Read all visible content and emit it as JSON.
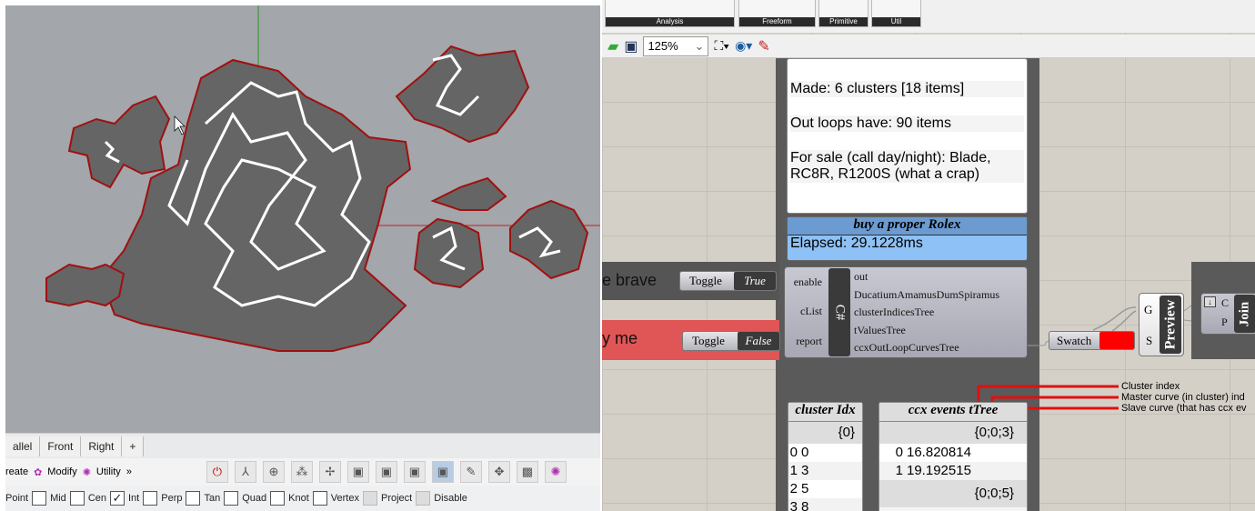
{
  "rhino": {
    "view_tabs": [
      "allel",
      "Front",
      "Right",
      "+"
    ],
    "toolbar_tabs": [
      {
        "label": "reate"
      },
      {
        "label": "Modify",
        "icon": "modify-icon"
      },
      {
        "label": "Utility",
        "icon": "utility-icon"
      },
      {
        "label": "»"
      }
    ],
    "osnaps": [
      {
        "label": "Point",
        "checked": null
      },
      {
        "label": "Mid",
        "checked": false
      },
      {
        "label": "Cen",
        "checked": false
      },
      {
        "label": "Int",
        "checked": true
      },
      {
        "label": "Perp",
        "checked": false
      },
      {
        "label": "Tan",
        "checked": false
      },
      {
        "label": "Quad",
        "checked": false
      },
      {
        "label": "Knot",
        "checked": false
      },
      {
        "label": "Vertex",
        "checked": false
      },
      {
        "label": "Project",
        "checked": false,
        "disabled": true
      },
      {
        "label": "Disable",
        "checked": false,
        "disabled": true
      }
    ]
  },
  "grasshopper": {
    "ribbon_groups": [
      "Analysis",
      "Freeform",
      "Primitive",
      "Util"
    ],
    "zoom": "125%",
    "panel_lines": [
      "Made: 6 clusters [18 items]",
      "Out loops have: 90 items",
      "For sale (call day/night): Blade, RC8R, R1200S (what a crap)"
    ],
    "timer": {
      "title": "buy a proper Rolex",
      "text": "Elapsed: 29.1228ms"
    },
    "group_brave": "e brave",
    "group_me": "y me",
    "toggle_true": {
      "label": "Toggle",
      "value": "True"
    },
    "toggle_false": {
      "label": "Toggle",
      "value": "False"
    },
    "csharp": {
      "name": "C#",
      "inputs": [
        "enable",
        "cList",
        "report"
      ],
      "outputs": [
        "out",
        "DucatiumAmamusDumSpiramus",
        "clusterIndicesTree",
        "tValuesTree",
        "ccxOutLoopCurvesTree"
      ]
    },
    "swatch": {
      "label": "Swatch",
      "color": "#ff0000"
    },
    "preview": {
      "name": "Preview",
      "inputs": [
        "G",
        "S"
      ]
    },
    "join": {
      "name": "Join",
      "inputs": [
        "C",
        "P"
      ]
    },
    "annotations": [
      "Cluster index",
      "Master curve (in cluster) ind",
      "Slave curve (that has ccx ev"
    ],
    "cluster_idx": {
      "title": "cluster Idx",
      "path": "{0}",
      "rows": [
        [
          "0",
          "0"
        ],
        [
          "1",
          "3"
        ],
        [
          "2",
          "5"
        ],
        [
          "3",
          "8"
        ]
      ]
    },
    "ccx_events": {
      "title": "ccx events tTree",
      "path1": "{0;0;3}",
      "rows": [
        [
          "0",
          "16.820814"
        ],
        [
          "1",
          "19.192515"
        ]
      ],
      "path2": "{0;0;5}"
    }
  },
  "colors": {
    "curve_fill": "#656565",
    "curve_outline": "#a01010",
    "accent_red": "#ff0000",
    "timer_blue": "#8ec1f5"
  }
}
